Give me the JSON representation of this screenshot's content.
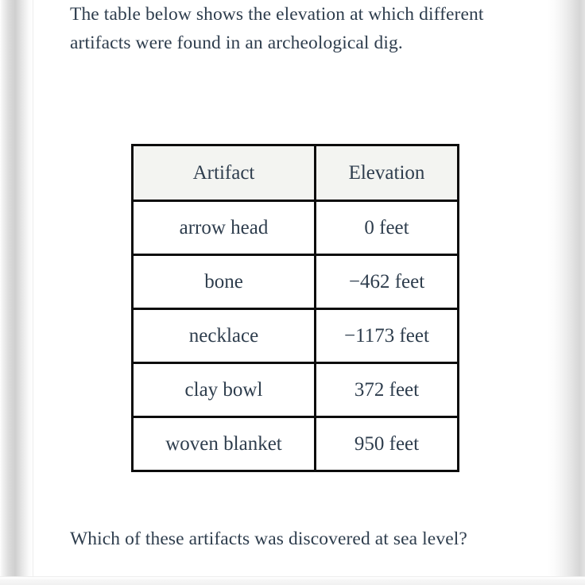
{
  "page": {
    "background_color": "#ffffff",
    "text_color": "#2e3d4d",
    "border_color": "#0c0c0c",
    "header_fill_color": "#f3f4f1"
  },
  "intro": {
    "text": "The table below shows the elevation at which different artifacts were found in an archeological dig."
  },
  "table": {
    "columns": [
      "Artifact",
      "Elevation"
    ],
    "rows": [
      {
        "artifact": "arrow head",
        "elevation": "0 feet"
      },
      {
        "artifact": "bone",
        "elevation": "−462 feet"
      },
      {
        "artifact": "necklace",
        "elevation": "−1173 feet"
      },
      {
        "artifact": "clay bowl",
        "elevation": "372 feet"
      },
      {
        "artifact": "woven blanket",
        "elevation": "950 feet"
      }
    ]
  },
  "question": {
    "text": "Which of these artifacts was discovered at sea level?"
  }
}
